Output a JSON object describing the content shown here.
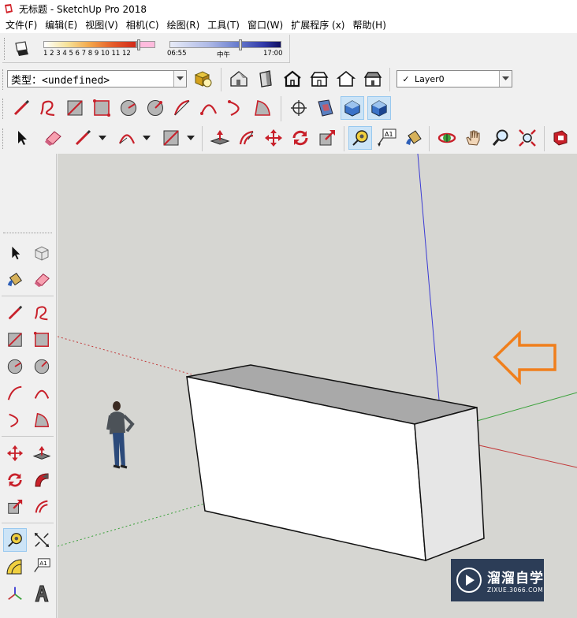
{
  "window": {
    "title": "无标题 - SketchUp Pro 2018"
  },
  "menu": [
    "文件(F)",
    "编辑(E)",
    "视图(V)",
    "相机(C)",
    "绘图(R)",
    "工具(T)",
    "窗口(W)",
    "扩展程序 (x)",
    "帮助(H)"
  ],
  "shadows": {
    "month_labels": "1  2  3  4  5  6  7  8  9  10 11 12",
    "time_start": "06:55",
    "time_mid": "中午",
    "time_end": "17:00"
  },
  "entity_info": {
    "type_label": "类型：<undefined>"
  },
  "layers": {
    "current": "Layer0",
    "check": "✓"
  },
  "toolbars": {
    "styles_icons": [
      "house-front-icon",
      "door-icon",
      "house-outline-icon",
      "house-hidden-icon",
      "house-wireframe-icon",
      "house-shaded-icon"
    ],
    "drawing_icons": [
      "pencil-icon",
      "freehand-icon",
      "rectangle-icon",
      "rotated-rectangle-icon",
      "circle-icon",
      "polygon-icon",
      "arc-icon",
      "two-point-arc-icon",
      "three-point-arc-icon",
      "pie-icon"
    ],
    "view_icons": [
      "position-camera-icon",
      "section-plane-icon",
      "display-section-icon",
      "display-section-cut-icon"
    ],
    "principal_icons": [
      "select-icon",
      "eraser-icon",
      "pencil-icon",
      "arc-icon",
      "rectangle-icon",
      "push-pull-icon",
      "offset-icon",
      "move-icon",
      "rotate-icon",
      "scale-icon",
      "tape-measure-icon",
      "text-icon",
      "paint-bucket-icon",
      "orbit-icon",
      "pan-icon",
      "zoom-icon",
      "zoom-extents-icon",
      "warehouse-icon"
    ]
  },
  "colors": {
    "accent_red": "#d2232a",
    "active_blue": "#cce4f7",
    "viewport_bg": "#d6d6d2",
    "axis_blue": "#3b3bd4",
    "axis_green": "#3aa13a",
    "axis_red": "#c23a3a",
    "arrow_orange": "#f07f1c"
  },
  "watermark": {
    "title": "溜溜自学",
    "url": "ZIXUE.3066.COM"
  }
}
